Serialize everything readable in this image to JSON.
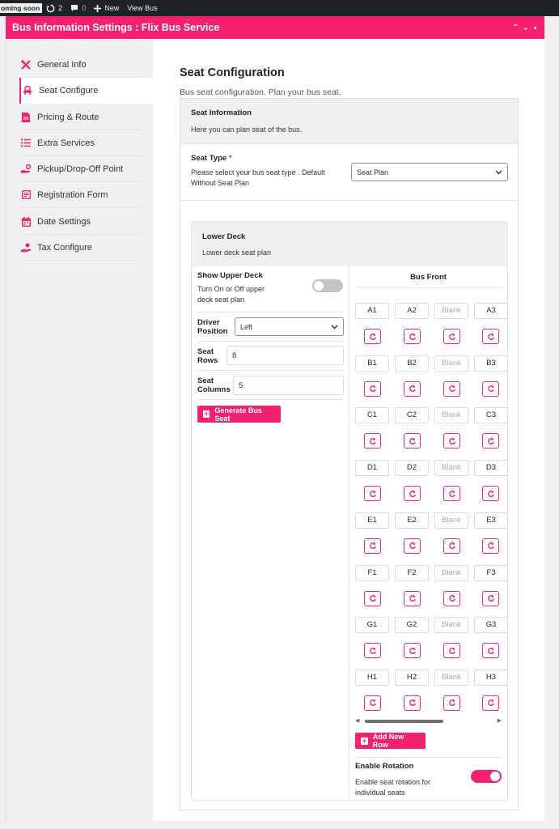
{
  "adminbar": {
    "coming_soon": "oming soon",
    "updates_count": "2",
    "comments_count": "0",
    "new_label": "New",
    "view_label": "View Bus"
  },
  "header": {
    "title": "Bus Information Settings : Flix Bus Service"
  },
  "nav": {
    "items": [
      {
        "label": "General Info",
        "icon": "tools-icon"
      },
      {
        "label": "Seat Configure",
        "icon": "seat-icon"
      },
      {
        "label": "Pricing & Route",
        "icon": "document-icon"
      },
      {
        "label": "Extra Services",
        "icon": "list-icon"
      },
      {
        "label": "Pickup/Drop-Off Point",
        "icon": "pickup-icon"
      },
      {
        "label": "Registration Form",
        "icon": "form-icon"
      },
      {
        "label": "Date Settings",
        "icon": "calendar-icon"
      },
      {
        "label": "Tax Configure",
        "icon": "tax-icon"
      }
    ],
    "active_index": 1
  },
  "page": {
    "title": "Seat Configuration",
    "subtitle": "Bus seat configuration. Plan your bus seat."
  },
  "seat_info": {
    "title": "Seat Information",
    "description": "Here you can plan seat of the bus."
  },
  "seat_type": {
    "label": "Seat Type",
    "required_mark": "*",
    "description": "Please select your bus seat type . Default Without Seat Plan",
    "selected": "Seat Plan"
  },
  "deck": {
    "title": "Lower Deck",
    "description": "Lower deck seat plan",
    "show_upper": {
      "label": "Show Upper Deck",
      "description": "Turn On or Off upper deck seat plan",
      "enabled": false
    },
    "driver_position": {
      "label": "Driver Position",
      "selected": "Left"
    },
    "seat_rows": {
      "label": "Seat Rows",
      "value": "8"
    },
    "seat_columns": {
      "label": "Seat Columns",
      "value": "5"
    },
    "generate_label": "Generate Bus Seat",
    "bus_front_label": "Bus Front",
    "seat_rows_grid": [
      [
        "A1",
        "A2",
        "Blank",
        "A3"
      ],
      [
        "B1",
        "B2",
        "Blank",
        "B3"
      ],
      [
        "C1",
        "C2",
        "Blank",
        "C3"
      ],
      [
        "D1",
        "D2",
        "Blank",
        "D3"
      ],
      [
        "E1",
        "E2",
        "Blank",
        "E3"
      ],
      [
        "F1",
        "F2",
        "Blank",
        "F3"
      ],
      [
        "G1",
        "G2",
        "Blank",
        "G3"
      ],
      [
        "H1",
        "H2",
        "Blank",
        "H3"
      ]
    ],
    "add_row_label": "Add New Row",
    "rotation": {
      "label": "Enable Rotation",
      "description": "Enable seat rotation for individual seats",
      "enabled": true
    }
  },
  "colors": {
    "accent": "#f5206e",
    "adminbar": "#1d2327"
  }
}
